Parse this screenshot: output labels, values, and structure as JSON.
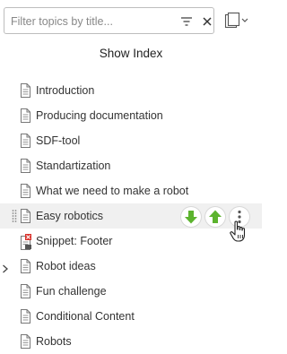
{
  "search": {
    "placeholder": "Filter topics by title..."
  },
  "icons": {
    "filter": "funnel-icon",
    "clear": "close-icon",
    "view": "copy-layers-icon",
    "view_menu": "chevron-down-icon",
    "topic": "document-icon",
    "snippet": "snippet-error-icon",
    "move_down": "arrow-down-icon",
    "move_up": "arrow-up-icon",
    "more": "more-vertical-icon",
    "expand": "chevron-right-icon",
    "drag": "drag-handle-icon",
    "cursor": "hand-pointer-icon"
  },
  "header": {
    "show_index": "Show Index"
  },
  "topics": [
    {
      "label": "Introduction"
    },
    {
      "label": "Producing documentation"
    },
    {
      "label": "SDF-tool"
    },
    {
      "label": "Standartization"
    },
    {
      "label": "What we need to make a robot"
    },
    {
      "label": "Easy robotics",
      "selected": true
    },
    {
      "label": "Snippet: Footer",
      "snippet": true
    },
    {
      "label": "Robot ideas",
      "expandable": true
    },
    {
      "label": "Fun challenge"
    },
    {
      "label": "Conditional Content"
    },
    {
      "label": "Robots"
    }
  ],
  "colors": {
    "accent_green": "#5cb32e",
    "selected_row": "#f0f0f0",
    "error_red": "#d9302a"
  }
}
